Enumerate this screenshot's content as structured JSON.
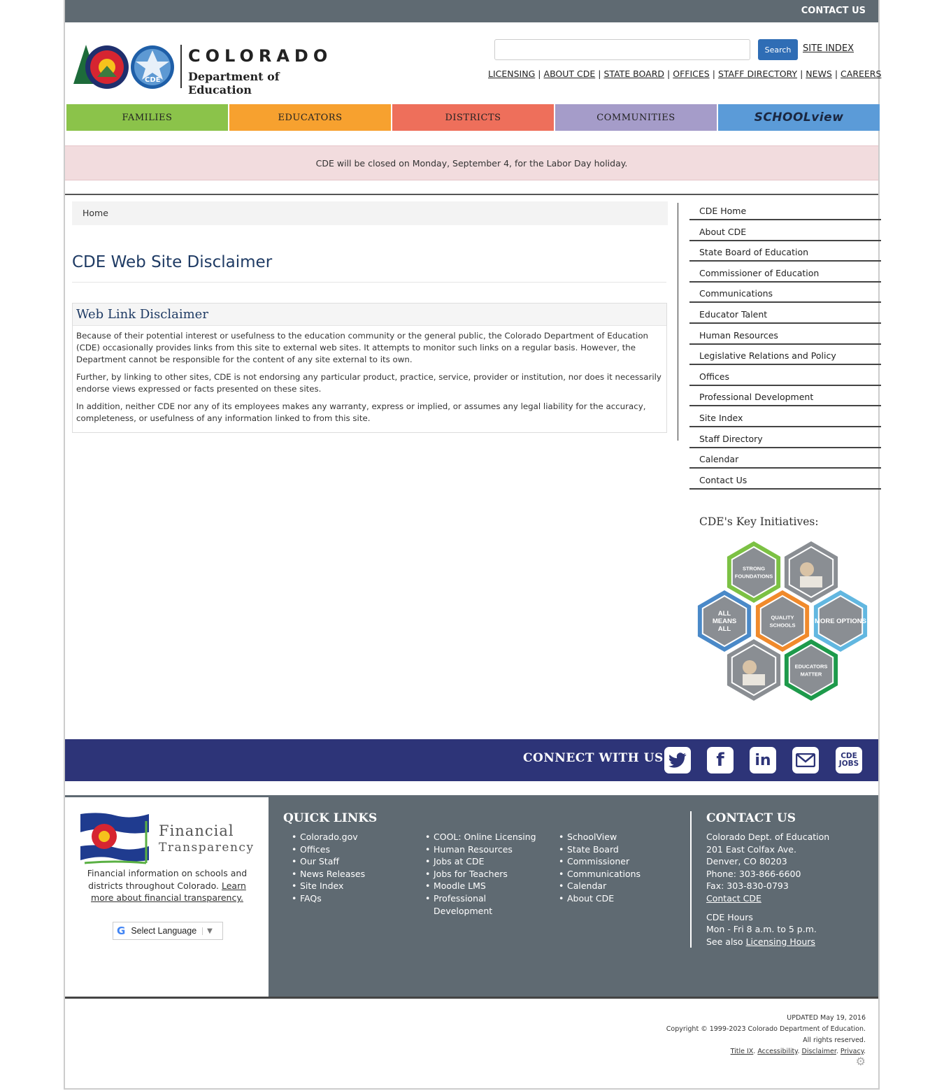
{
  "topbar": {
    "contact": "CONTACT US"
  },
  "logo": {
    "line1": "COLORADO",
    "line2": "Department of Education",
    "badge": "CDE"
  },
  "search": {
    "placeholder": "",
    "button": "Search",
    "site_index": "SITE INDEX"
  },
  "utility_links": [
    "LICENSING",
    "ABOUT CDE",
    "STATE BOARD",
    "OFFICES",
    "STAFF DIRECTORY",
    "NEWS",
    "CAREERS"
  ],
  "nav": [
    {
      "label": "FAMILIES",
      "color": "#8bc34a"
    },
    {
      "label": "EDUCATORS",
      "color": "#f7a12f"
    },
    {
      "label": "DISTRICTS",
      "color": "#ee6f5b"
    },
    {
      "label": "COMMUNITIES",
      "color": "#a59cc9"
    },
    {
      "label": "SCHOOLview",
      "color": "#5b9bd8"
    }
  ],
  "alert": "CDE will be closed on Monday, September 4, for the Labor Day holiday.",
  "breadcrumb": "Home",
  "page_title": "CDE Web Site Disclaimer",
  "panel": {
    "heading": "Web Link Disclaimer",
    "p1": "Because of their potential interest or usefulness to the education community or the general public, the Colorado Department of Education (CDE) occasionally provides links from this site to external web sites. It attempts to monitor such links on a regular basis. However, the Department cannot be responsible for the content of any site external to its own.",
    "p2": "Further, by linking to other sites, CDE is not endorsing any particular product, practice, service, provider or institution, nor does it necessarily endorse views expressed or facts presented on these sites.",
    "p3": "In addition, neither CDE nor any of its employees makes any warranty, express or implied, or assumes any legal liability for the accuracy, completeness, or usefulness of any information linked to from this site."
  },
  "sidenav": [
    "CDE Home",
    "About CDE",
    "State Board of Education",
    "Commissioner of Education",
    "Communications",
    "Educator Talent",
    "Human Resources",
    "Legislative Relations and Policy",
    "Offices",
    "Professional Development",
    "Site Index",
    "Staff Directory",
    "Calendar",
    "Contact Us"
  ],
  "key_initiatives": {
    "title": "CDE's Key Initiatives:",
    "hexes": [
      {
        "label": "STRONG FOUNDATIONS",
        "color": "#7cc144"
      },
      {
        "label": "",
        "color": "#8a8e93"
      },
      {
        "label": "ALL MEANS ALL",
        "color": "#4a89c8"
      },
      {
        "label": "QUALITY SCHOOLS",
        "color": "#f08a2c"
      },
      {
        "label": "MORE OPTIONS",
        "color": "#62b7e0"
      },
      {
        "label": "",
        "color": "#8a8e93"
      },
      {
        "label": "EDUCATORS MATTER",
        "color": "#1e9a4b"
      }
    ]
  },
  "connect": {
    "label": "CONNECT WITH US",
    "jobs": "CDE JOBS"
  },
  "footer": {
    "fin_title1": "Financial",
    "fin_title2": "Transparency",
    "fin_text": "Financial information on schools and districts throughout Colorado.",
    "fin_link": "Learn more about financial transparency.",
    "language": "Select Language",
    "quick_links_title": "QUICK LINKS",
    "col1": [
      "Colorado.gov",
      "Offices",
      "Our Staff",
      "News Releases",
      "Site Index",
      "FAQs"
    ],
    "col2": [
      "COOL: Online Licensing",
      "Human Resources",
      "Jobs at CDE",
      "Jobs for Teachers",
      "Moodle LMS",
      "Professional Development"
    ],
    "col3": [
      "SchoolView",
      "State Board",
      "Commissioner",
      "Communications",
      "Calendar",
      "About CDE"
    ],
    "contact_title": "CONTACT US",
    "contact_lines": [
      "Colorado Dept. of Education",
      "201 East Colfax Ave.",
      "Denver, CO 80203",
      "Phone: 303-866-6600",
      "Fax: 303-830-0793"
    ],
    "contact_link": "Contact CDE",
    "hours_title": "CDE Hours",
    "hours": "Mon - Fri 8 a.m. to 5 p.m.",
    "see_also": "See also",
    "licensing_hours": "Licensing Hours"
  },
  "legal": {
    "updated": "UPDATED May 19, 2016",
    "copyright": "Copyright © 1999-2023 Colorado Department of Education.",
    "rights": "All rights reserved.",
    "links": [
      "Title IX",
      "Accessibility",
      "Disclaimer",
      "Privacy"
    ]
  }
}
